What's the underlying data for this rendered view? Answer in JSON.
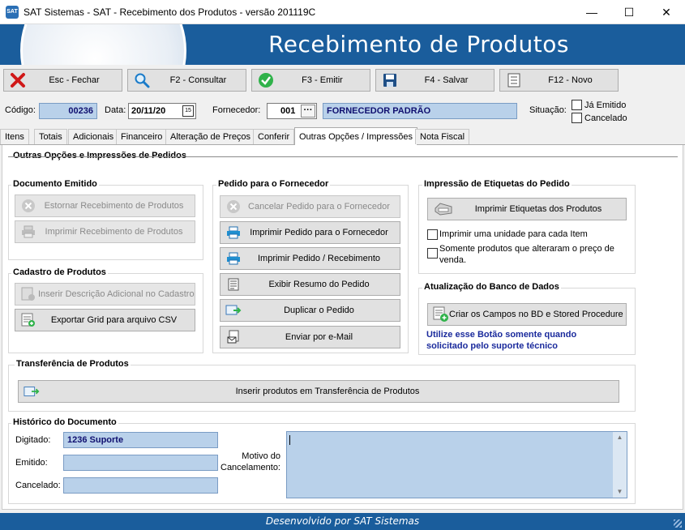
{
  "window": {
    "title": "SAT Sistemas - SAT - Recebimento dos Produtos - versão 201119C",
    "app_icon_text": "SAT"
  },
  "banner": {
    "title": "Recebimento de Produtos"
  },
  "toolbar": {
    "close": "Esc - Fechar",
    "consult": "F2 - Consultar",
    "emit": "F3 - Emitir",
    "save": "F4 - Salvar",
    "new": "F12 - Novo"
  },
  "header": {
    "codigo_label": "Código:",
    "codigo": "00236",
    "data_label": "Data:",
    "data": "20/11/20",
    "fornecedor_label": "Fornecedor:",
    "fornecedor_code": "001",
    "fornecedor_name": "FORNECEDOR PADRÃO",
    "situacao_label": "Situação:",
    "ja_emitido": "Já Emitido",
    "cancelado": "Cancelado"
  },
  "tabs": [
    "Itens",
    "Totais",
    "Adicionais",
    "Financeiro",
    "Alteração de Preços",
    "Conferir",
    "Outras Opções / Impressões",
    "Nota Fiscal"
  ],
  "section_title": "Outras Opções e Impressões de Pedidos",
  "doc_emitido": {
    "title": "Documento Emitido",
    "estornar": "Estornar Recebimento de Produtos",
    "imprimir": "Imprimir Recebimento de Produtos"
  },
  "cadastro": {
    "title": "Cadastro de Produtos",
    "inserir_desc": "Inserir Descrição Adicional no Cadastro",
    "exportar": "Exportar Grid para arquivo CSV"
  },
  "pedido_fornecedor": {
    "title": "Pedido para o Fornecedor",
    "cancelar": "Cancelar Pedido para o Fornecedor",
    "imprimir": "Imprimir Pedido para o Fornecedor",
    "imprimir_receb": "Imprimir Pedido / Recebimento",
    "resumo": "Exibir Resumo do Pedido",
    "duplicar": "Duplicar o Pedido",
    "email": "Enviar por  e-Mail"
  },
  "etiquetas": {
    "title": "Impressão de Etiquetas do Pedido",
    "imprimir": "Imprimir Etiquetas dos Produtos",
    "opt_unidade": "Imprimir uma unidade para cada Item",
    "opt_preco_1": "Somente produtos que alteraram o preço de",
    "opt_preco_2": "venda."
  },
  "banco": {
    "title": "Atualização do Banco de Dados",
    "criar": "Criar os Campos no BD e Stored Procedure",
    "warn_1": "Utilize esse Botão somente quando",
    "warn_2": "solicitado pelo suporte técnico"
  },
  "transferencia": {
    "title": "Transferência de Produtos",
    "inserir": "Inserir produtos em Transferência de Produtos"
  },
  "historico": {
    "title": "Histórico do Documento",
    "digitado_label": "Digitado:",
    "digitado": "1236 Suporte",
    "emitido_label": "Emitido:",
    "emitido": "",
    "cancelado_label": "Cancelado:",
    "cancelado": "",
    "motivo_label_1": "Motivo do",
    "motivo_label_2": "Cancelamento:",
    "motivo": ""
  },
  "status": {
    "text": "Desenvolvido por SAT Sistemas"
  },
  "colors": {
    "brand": "#1a5d9c",
    "field": "#b9d1ea",
    "field_text": "#101070",
    "warn_text": "#1a2a9c"
  }
}
